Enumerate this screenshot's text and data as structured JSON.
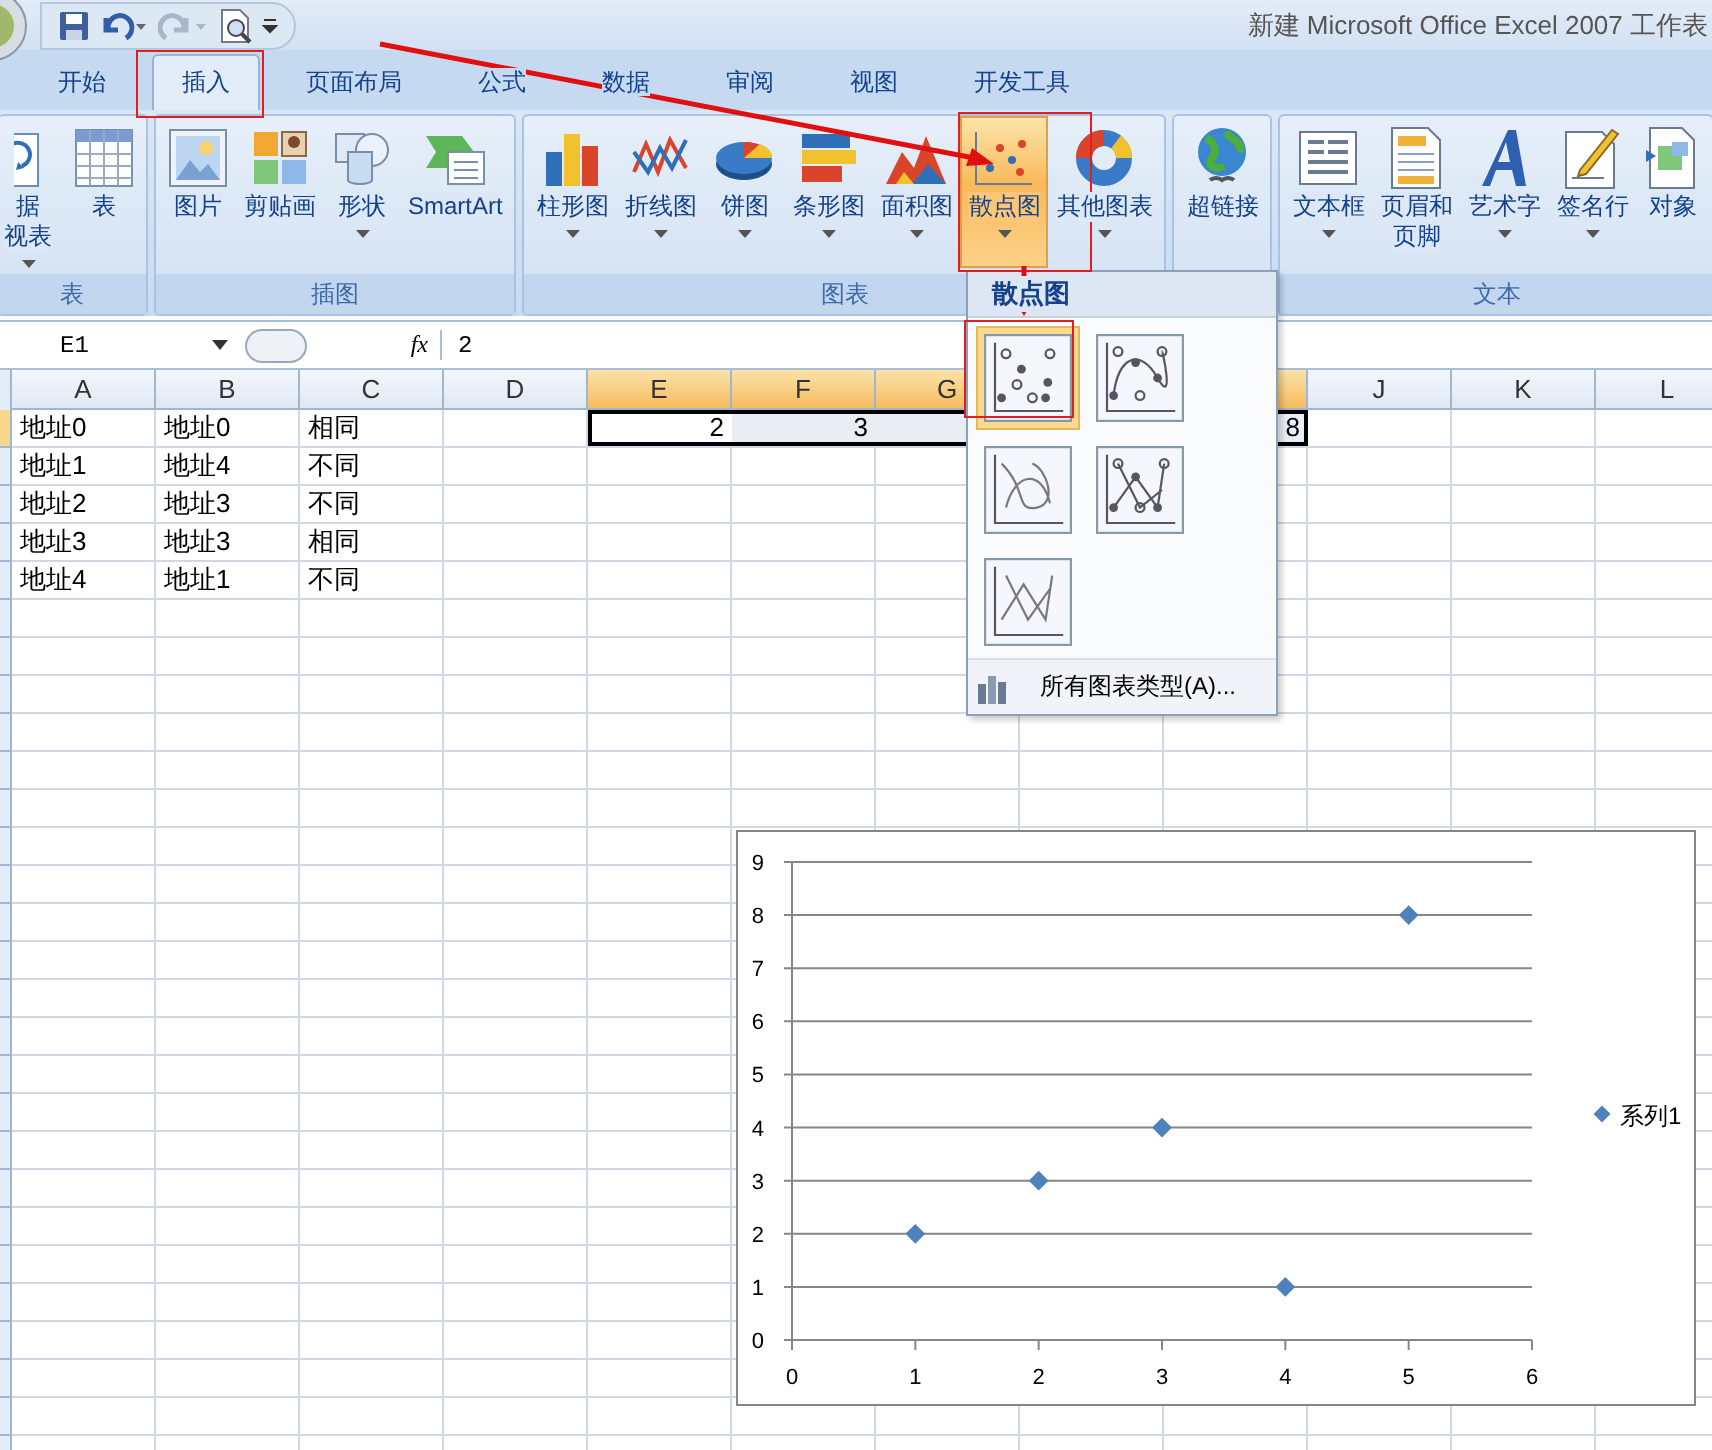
{
  "window": {
    "title": "新建 Microsoft Office Excel 2007 工作表"
  },
  "tabs": [
    {
      "label": "开始",
      "selected": false
    },
    {
      "label": "插入",
      "selected": true
    },
    {
      "label": "页面布局",
      "selected": false
    },
    {
      "label": "公式",
      "selected": false
    },
    {
      "label": "数据",
      "selected": false
    },
    {
      "label": "审阅",
      "selected": false
    },
    {
      "label": "视图",
      "selected": false
    },
    {
      "label": "开发工具",
      "selected": false
    }
  ],
  "ribbon": {
    "groups": [
      {
        "label": "表",
        "buttons": [
          {
            "lines": [
              "据",
              "视表"
            ],
            "has_menu": true,
            "selected": false
          },
          {
            "lines": [
              "表"
            ],
            "has_menu": false,
            "selected": false
          }
        ]
      },
      {
        "label": "插图",
        "buttons": [
          {
            "lines": [
              "图片"
            ],
            "has_menu": false,
            "selected": false
          },
          {
            "lines": [
              "剪贴画"
            ],
            "has_menu": false,
            "selected": false
          },
          {
            "lines": [
              "形状"
            ],
            "has_menu": true,
            "selected": false
          },
          {
            "lines": [
              "SmartArt"
            ],
            "has_menu": false,
            "selected": false
          }
        ]
      },
      {
        "label": "图表",
        "buttons": [
          {
            "lines": [
              "柱形图"
            ],
            "has_menu": true,
            "selected": false
          },
          {
            "lines": [
              "折线图"
            ],
            "has_menu": true,
            "selected": false
          },
          {
            "lines": [
              "饼图"
            ],
            "has_menu": true,
            "selected": false
          },
          {
            "lines": [
              "条形图"
            ],
            "has_menu": true,
            "selected": false
          },
          {
            "lines": [
              "面积图"
            ],
            "has_menu": true,
            "selected": false
          },
          {
            "lines": [
              "散点图"
            ],
            "has_menu": true,
            "selected": true
          },
          {
            "lines": [
              "其他图表"
            ],
            "has_menu": true,
            "selected": false
          }
        ]
      },
      {
        "buttons": [
          {
            "lines": [
              "超链接"
            ],
            "has_menu": false,
            "selected": false
          }
        ]
      },
      {
        "label": "文本",
        "buttons": [
          {
            "lines": [
              "文本框"
            ],
            "has_menu": true,
            "selected": false
          },
          {
            "lines": [
              "页眉和",
              "页脚"
            ],
            "has_menu": false,
            "selected": false
          },
          {
            "lines": [
              "艺术字"
            ],
            "has_menu": true,
            "selected": false
          },
          {
            "lines": [
              "签名行"
            ],
            "has_menu": true,
            "selected": false
          },
          {
            "lines": [
              "对象"
            ],
            "has_menu": false,
            "selected": false
          }
        ]
      }
    ]
  },
  "formula_bar": {
    "name_box": "E1",
    "function_label": "fx",
    "value": "2"
  },
  "sheet": {
    "columns": [
      {
        "label": "A",
        "selected": false
      },
      {
        "label": "B",
        "selected": false
      },
      {
        "label": "C",
        "selected": false
      },
      {
        "label": "D",
        "selected": false
      },
      {
        "label": "E",
        "selected": true
      },
      {
        "label": "F",
        "selected": true
      },
      {
        "label": "G",
        "selected": true
      },
      {},
      {
        "selected": true
      },
      {
        "label": "J",
        "selected": false
      },
      {
        "label": "K",
        "selected": false
      },
      {
        "label": "L",
        "selected": false
      }
    ],
    "rows": [
      {
        "cells": [
          {
            "text": "地址0"
          },
          {
            "text": "地址0"
          },
          {
            "text": "相同"
          },
          {},
          {
            "text": "2",
            "kind": "number",
            "selected": true
          },
          {
            "text": "3",
            "kind": "number",
            "selected": true
          },
          {
            "selected": true
          },
          {},
          {
            "text": "8",
            "kind": "number",
            "selected": true
          }
        ]
      },
      {
        "cells": [
          {
            "text": "地址1"
          },
          {
            "text": "地址4"
          },
          {
            "text": "不同"
          }
        ]
      },
      {
        "cells": [
          {
            "text": "地址2"
          },
          {
            "text": "地址3"
          },
          {
            "text": "不同"
          }
        ]
      },
      {
        "cells": [
          {
            "text": "地址3"
          },
          {
            "text": "地址3"
          },
          {
            "text": "相同"
          }
        ]
      },
      {
        "cells": [
          {
            "text": "地址4"
          },
          {
            "text": "地址1"
          },
          {
            "text": "不同"
          }
        ]
      }
    ]
  },
  "dropdown": {
    "title": "散点图",
    "options": [
      {
        "selected": true
      },
      {
        "selected": false
      },
      {
        "selected": false
      },
      {
        "selected": false
      },
      {
        "selected": false
      }
    ],
    "footer": "所有图表类型(A)..."
  },
  "chart": {
    "chart_data": {
      "type": "scatter",
      "x": [
        1,
        2,
        3,
        4,
        5
      ],
      "series": [
        {
          "name": "系列1",
          "color": "#4f81bd",
          "values": [
            2,
            3,
            4,
            1,
            8
          ]
        }
      ],
      "grid": true,
      "xlim": [
        0,
        6
      ],
      "ylim": [
        0,
        9
      ],
      "xticks": [
        0,
        1,
        2,
        3,
        4,
        5,
        6
      ],
      "yticks": [
        0,
        1,
        2,
        3,
        4,
        5,
        6,
        7,
        8,
        9
      ]
    }
  }
}
